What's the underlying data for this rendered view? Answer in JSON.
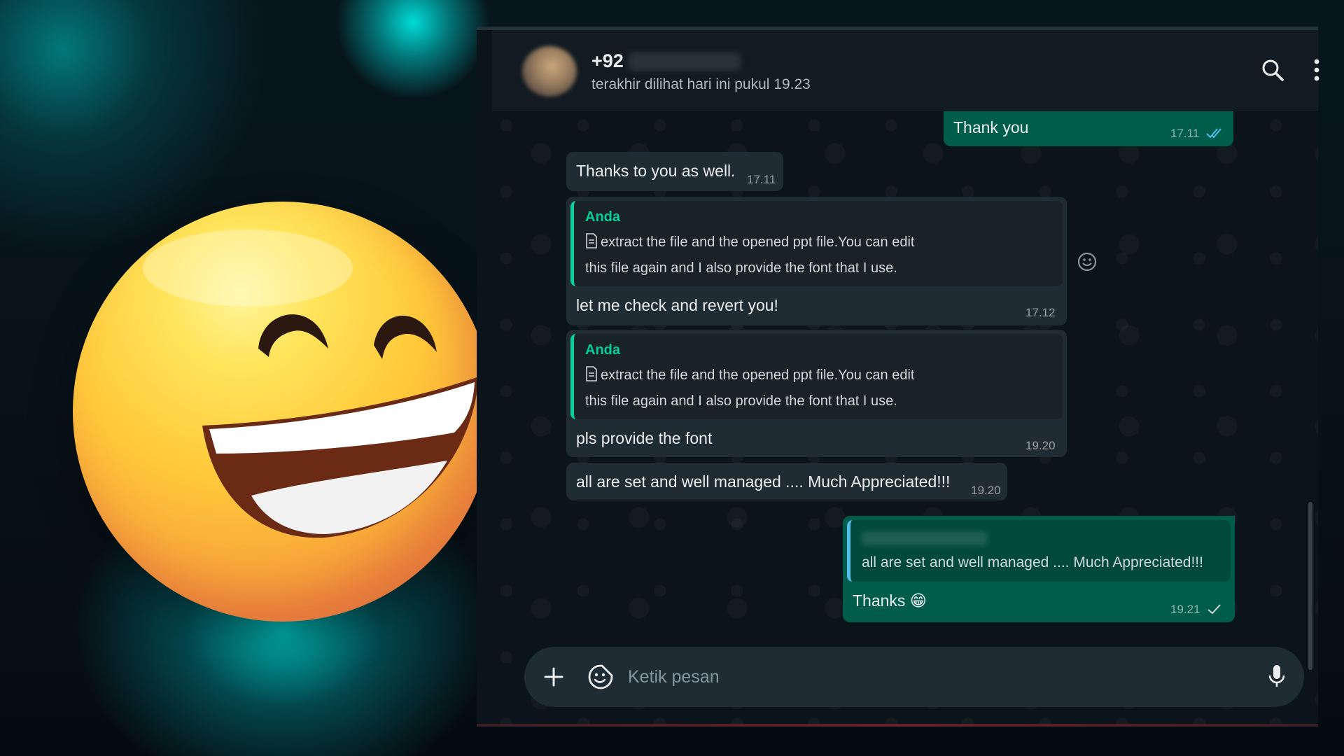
{
  "header": {
    "contact_name": "+92",
    "last_seen": "terakhir dilihat hari ini pukul 19.23",
    "search_icon": "search-icon",
    "menu_icon": "more-vertical-icon"
  },
  "messages": [
    {
      "direction": "outgoing",
      "text": "Thank you",
      "time": "17.11",
      "status": "read"
    },
    {
      "direction": "incoming",
      "text": "Thanks to you as well.",
      "time": "17.11"
    },
    {
      "direction": "incoming",
      "quote_author": "Anda",
      "quote_line1": "extract the file and the opened ppt file.You can edit",
      "quote_line2": "this file again and I also provide the font that I use.",
      "text": "let me check and revert you!",
      "time": "17.12"
    },
    {
      "direction": "incoming",
      "quote_author": "Anda",
      "quote_line1": "extract the file and the opened ppt file.You can edit",
      "quote_line2": "this file again and I also provide the font that I use.",
      "text": "pls provide the font",
      "time": "19.20"
    },
    {
      "direction": "incoming",
      "text": "all are set and well managed .... Much Appreciated!!!",
      "time": "19.20"
    },
    {
      "direction": "outgoing",
      "quote_text": "all are set and well managed .... Much Appreciated!!!",
      "text": "Thanks 😁",
      "time": "19.21",
      "status": "sent"
    }
  ],
  "composer": {
    "placeholder": "Ketik pesan",
    "attach_icon": "plus-icon",
    "sticker_icon": "sticker-icon",
    "mic_icon": "microphone-icon"
  },
  "colors": {
    "incoming_bubble": "#202c33",
    "outgoing_bubble": "#005c4b",
    "accent": "#06cf9c",
    "read_tick": "#53bdeb",
    "background": "#0b141a"
  }
}
